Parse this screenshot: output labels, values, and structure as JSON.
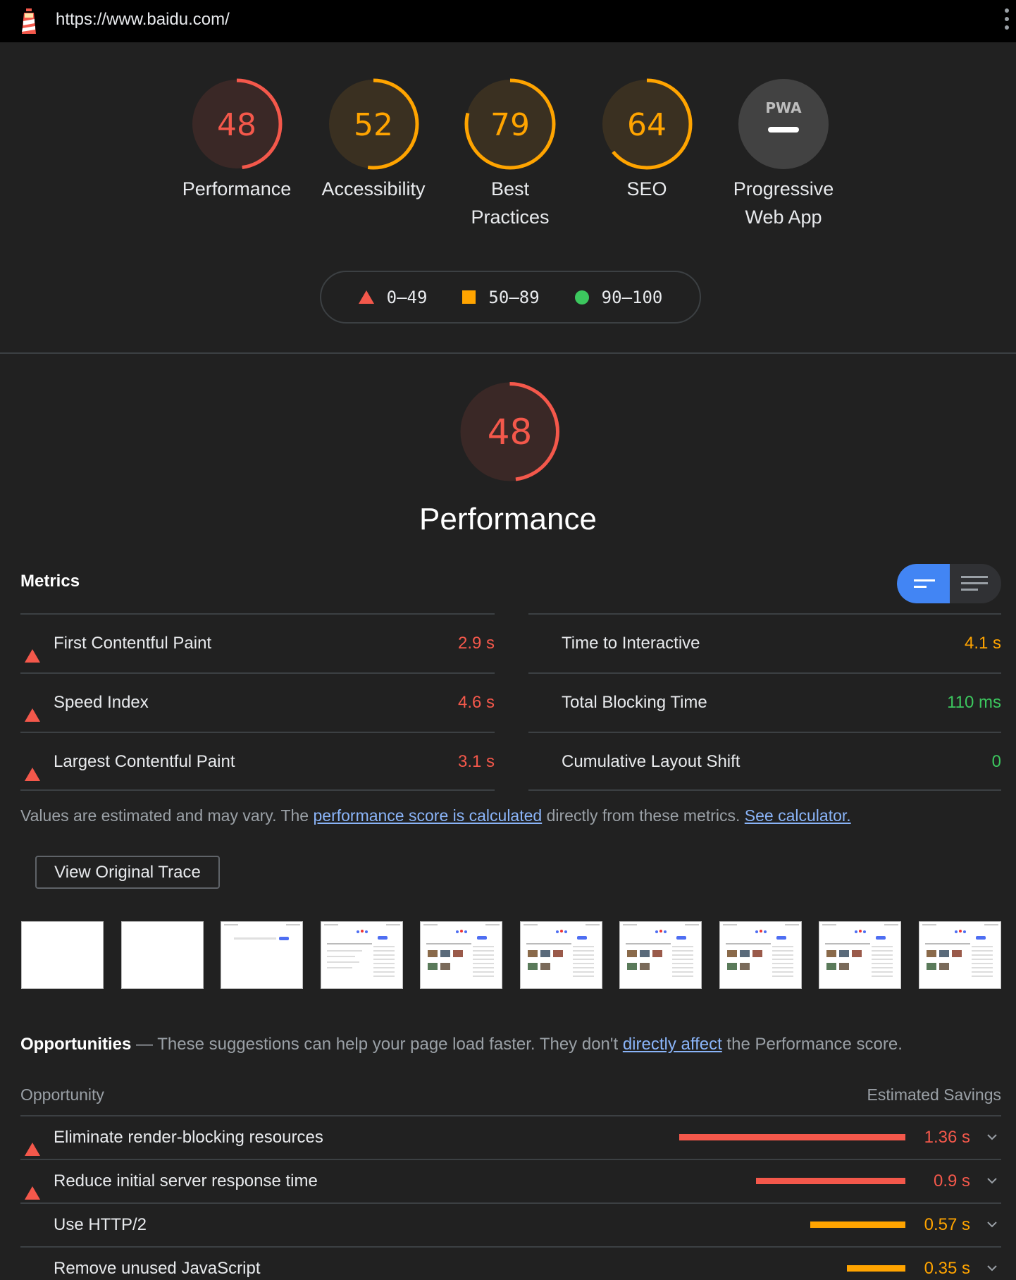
{
  "browser": {
    "url": "https://www.baidu.com/"
  },
  "colors": {
    "fail": "#f4584b",
    "average": "#ffa400",
    "pass": "#3cc75e",
    "accent": "#4285f4"
  },
  "categories": [
    {
      "label": "Performance",
      "score": "48",
      "fraction": 0.48,
      "status": "fail"
    },
    {
      "label": "Accessibility",
      "score": "52",
      "fraction": 0.52,
      "status": "average"
    },
    {
      "label": "Best Practices",
      "score": "79",
      "fraction": 0.79,
      "status": "average"
    },
    {
      "label": "SEO",
      "score": "64",
      "fraction": 0.64,
      "status": "average"
    },
    {
      "label": "Progressive Web App",
      "badge": "PWA",
      "status": "na"
    }
  ],
  "legend": [
    {
      "label": "0–49",
      "icon": "triangle"
    },
    {
      "label": "50–89",
      "icon": "square"
    },
    {
      "label": "90–100",
      "icon": "circle"
    }
  ],
  "performance": {
    "score": "48",
    "fraction": 0.48,
    "title": "Performance"
  },
  "metrics": {
    "title": "Metrics",
    "left": [
      {
        "name": "First Contentful Paint",
        "value": "2.9 s",
        "status": "fail"
      },
      {
        "name": "Speed Index",
        "value": "4.6 s",
        "status": "fail"
      },
      {
        "name": "Largest Contentful Paint",
        "value": "3.1 s",
        "status": "fail"
      }
    ],
    "right": [
      {
        "name": "Time to Interactive",
        "value": "4.1 s",
        "status": "average"
      },
      {
        "name": "Total Blocking Time",
        "value": "110 ms",
        "status": "pass"
      },
      {
        "name": "Cumulative Layout Shift",
        "value": "0",
        "status": "pass"
      }
    ]
  },
  "note": {
    "t1": "Values are estimated and may vary. The ",
    "link1": "performance score is calculated",
    "t2": " directly from these metrics. ",
    "link2": "See calculator."
  },
  "trace_button": "View Original Trace",
  "filmstrip_count": 10,
  "opportunities": {
    "title": "Opportunities",
    "dash": " — ",
    "t1": "These suggestions can help your page load faster. They don't ",
    "link": "directly affect",
    "t2": " the Performance score.",
    "col_left": "Opportunity",
    "col_right": "Estimated Savings",
    "items": [
      {
        "name": "Eliminate render-blocking resources",
        "value": "1.36 s",
        "seconds": 1.36,
        "status": "fail"
      },
      {
        "name": "Reduce initial server response time",
        "value": "0.9 s",
        "seconds": 0.9,
        "status": "fail"
      },
      {
        "name": "Use HTTP/2",
        "value": "0.57 s",
        "seconds": 0.57,
        "status": "average"
      },
      {
        "name": "Remove unused JavaScript",
        "value": "0.35 s",
        "seconds": 0.35,
        "status": "average"
      }
    ]
  }
}
